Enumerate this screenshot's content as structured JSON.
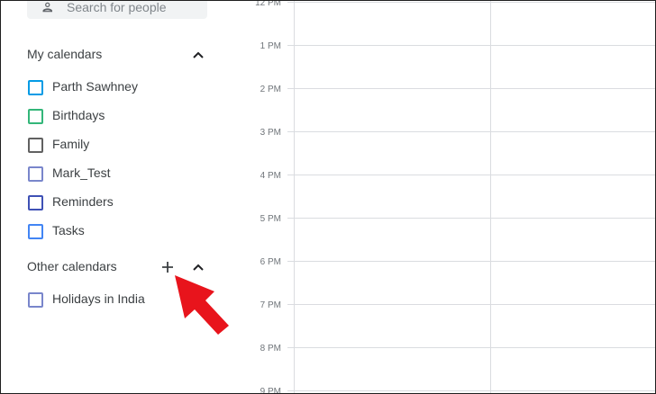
{
  "search": {
    "placeholder": "Search for people"
  },
  "my_calendars": {
    "title": "My calendars",
    "items": [
      {
        "label": "Parth Sawhney",
        "color": "#039be5"
      },
      {
        "label": "Birthdays",
        "color": "#33b679"
      },
      {
        "label": "Family",
        "color": "#616161"
      },
      {
        "label": "Mark_Test",
        "color": "#7986cb"
      },
      {
        "label": "Reminders",
        "color": "#3f51b5"
      },
      {
        "label": "Tasks",
        "color": "#4285f4"
      }
    ]
  },
  "other_calendars": {
    "title": "Other calendars",
    "items": [
      {
        "label": "Holidays in India",
        "color": "#7986cb"
      }
    ]
  },
  "time_slots": [
    "12 PM",
    "1 PM",
    "2 PM",
    "3 PM",
    "4 PM",
    "5 PM",
    "6 PM",
    "7 PM",
    "8 PM",
    "9 PM"
  ],
  "colors": {
    "annotation_arrow": "#e8141c",
    "gridline": "#dadce0"
  }
}
